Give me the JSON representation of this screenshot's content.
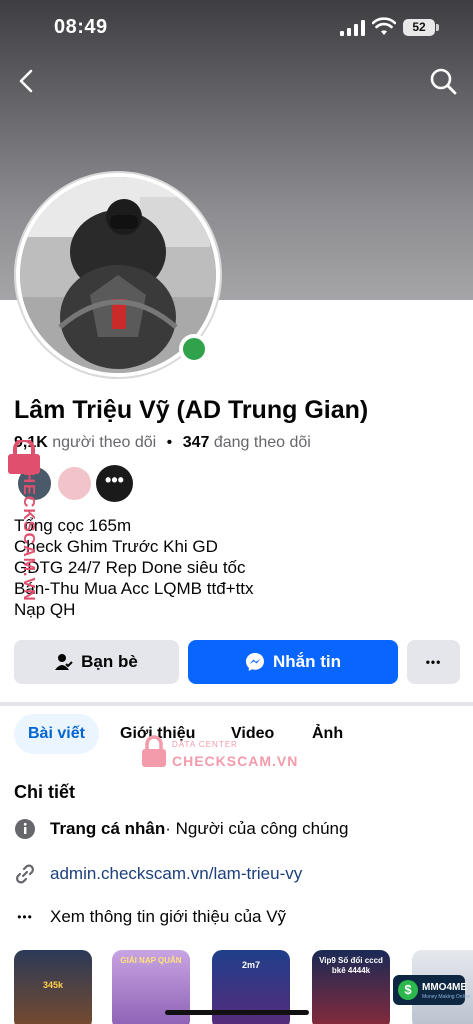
{
  "status_bar": {
    "time": "08:49",
    "battery": "52"
  },
  "profile": {
    "name": "Lâm Triệu Vỹ (AD Trung Gian)",
    "followers_count": "9,1K",
    "followers_label": "người theo dõi",
    "separator": "•",
    "following_count": "347",
    "following_label": "đang theo dõi"
  },
  "friends_more": "•••",
  "bio": [
    "Tổng cọc 165m",
    "Check Ghim Trước Khi GD",
    "GDTG 24/7 Rep Done siêu tốc",
    "Bán-Thu Mua Acc LQMB ttđ+ttx",
    "Nạp QH"
  ],
  "actions": {
    "friends": "Bạn bè",
    "message": "Nhắn tin",
    "more": "•••"
  },
  "tabs": [
    "Bài viết",
    "Giới thiệu",
    "Video",
    "Ảnh"
  ],
  "details": {
    "title": "Chi tiết",
    "page_type_label": "Trang cá nhân",
    "page_type_value": " · Người của công chúng",
    "link": "admin.checkscam.vn/lam-trieu-vy",
    "see_about": "Xem thông tin giới thiệu của Vỹ"
  },
  "thumbnails": [
    {
      "caption": "345k"
    },
    {
      "caption": "GIẢI NẠP QUÂN"
    },
    {
      "caption": "2m7"
    },
    {
      "caption": "Vip9 Số đổi cccd bkê 4444k"
    },
    {
      "caption": ""
    }
  ],
  "watermarks": {
    "side": "CHECKSCAM.VN",
    "center_sub": "DATA CENTER",
    "center_brand": "CHECKSCAM.VN",
    "badge": "MMO4ME",
    "badge_sub": "Money Making Online"
  },
  "colors": {
    "accent": "#0866ff",
    "online": "#31a24c",
    "button_gray": "#e4e6eb",
    "tab_active_bg": "#ebf5ff"
  }
}
